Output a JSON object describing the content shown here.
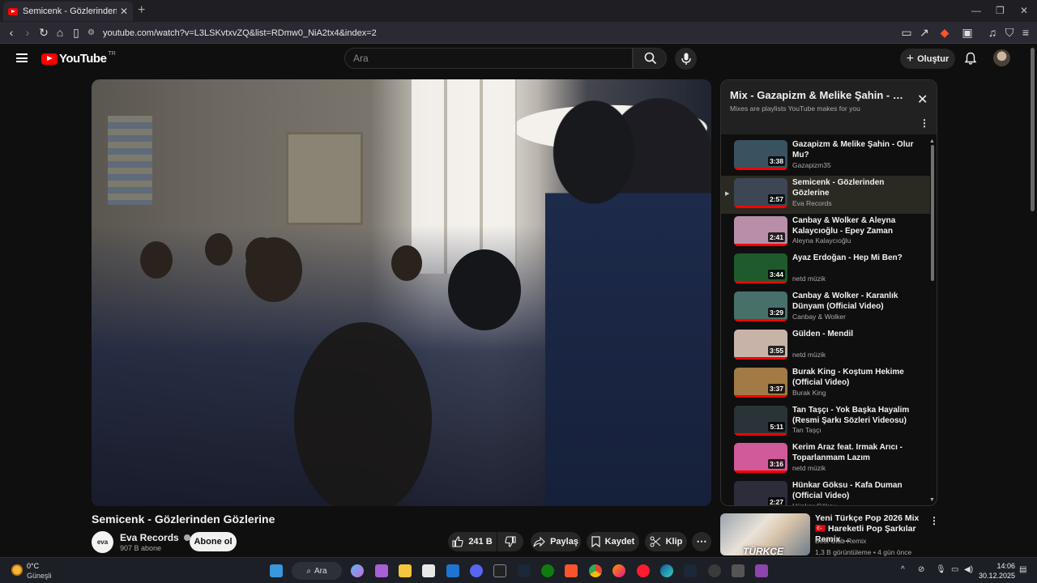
{
  "browser": {
    "tab_title": "Semicenk - Gözlerinden Gözlerine",
    "tab_close": "✕",
    "new_tab": "+",
    "url": "youtube.com/watch?v=L3LSKvtxvZQ&list=RDmw0_NiA2tx4&index=2"
  },
  "header": {
    "logo_text": "YouTube",
    "region": "TR",
    "search_placeholder": "Ara",
    "create_label": "Oluştur"
  },
  "video": {
    "title": "Semicenk - Gözlerinden Gözlerine",
    "channel": "Eva Records",
    "channel_avatar_text": "eva",
    "subscribers": "907 B abone",
    "subscribe_label": "Abone ol",
    "likes": "241 B",
    "share_label": "Paylaş",
    "save_label": "Kaydet",
    "clip_label": "Klip"
  },
  "playlist": {
    "title": "Mix - Gazapizm & Melike Şahin - Olur Mu?",
    "subtitle": "Mixes are playlists YouTube makes for you",
    "items": [
      {
        "title": "Gazapizm & Melike Şahin - Olur Mu?",
        "channel": "Gazapizm35",
        "duration": "3:38",
        "active": false,
        "thumb": "#3a5260"
      },
      {
        "title": "Semicenk - Gözlerinden Gözlerine",
        "channel": "Eva Records",
        "duration": "2:57",
        "active": true,
        "thumb": "#3c4654"
      },
      {
        "title": "Canbay & Wolker & Aleyna Kalaycıoğlu - Epey Zaman Olmuş",
        "channel": "Aleyna Kalaycıoğlu",
        "duration": "2:41",
        "active": false,
        "thumb": "#b88ea8"
      },
      {
        "title": "Ayaz Erdoğan - Hep Mi Ben?",
        "channel": "netd müzik",
        "duration": "3:44",
        "active": false,
        "thumb": "#1f5a2c"
      },
      {
        "title": "Canbay & Wolker - Karanlık Dünyam (Official Video)",
        "channel": "Canbay & Wolker",
        "duration": "3:29",
        "active": false,
        "thumb": "#48706a"
      },
      {
        "title": "Gülden - Mendil",
        "channel": "netd müzik",
        "duration": "3:55",
        "active": false,
        "thumb": "#c7b3a8"
      },
      {
        "title": "Burak King - Koştum Hekime (Official Video)",
        "channel": "Burak King",
        "duration": "3:37",
        "active": false,
        "thumb": "#a27a45"
      },
      {
        "title": "Tan Taşçı - Yok Başka Hayalim (Resmi Şarkı Sözleri Videosu)",
        "channel": "Tan Taşçı",
        "duration": "5:11",
        "active": false,
        "thumb": "#2a3338"
      },
      {
        "title": "Kerim Araz feat. Irmak Arıcı - Toparlanmam Lazım",
        "channel": "netd müzik",
        "duration": "3:16",
        "active": false,
        "thumb": "#d05a9a"
      },
      {
        "title": "Hünkar Göksu - Kafa Duman (Official Video)",
        "channel": "Hünkar Göksu",
        "duration": "2:27",
        "active": false,
        "thumb": "#2c2c3a"
      }
    ]
  },
  "recommended": {
    "title": "Yeni Türkçe Pop 2026 Mix 🇹🇷 Hareketli Pop Şarkılar Remix ...",
    "channel": "Best Club Remix",
    "meta": "1,3 B görüntüleme • 4 gün önce",
    "thumb_text": "TÜRKÇE"
  },
  "taskbar": {
    "temp": "0°C",
    "weather": "Güneşli",
    "search_label": "Ara",
    "time": "14:06",
    "date": "30.12.2025"
  }
}
